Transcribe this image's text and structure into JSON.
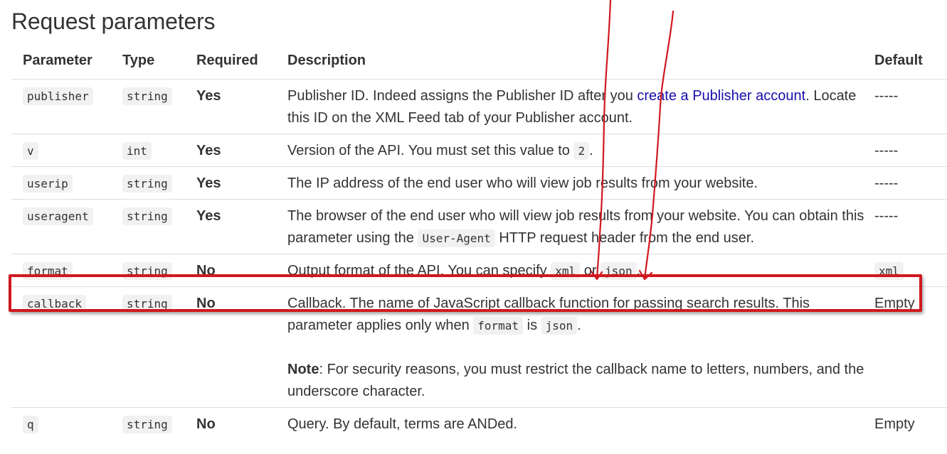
{
  "page": {
    "title": "Request parameters"
  },
  "table": {
    "headers": {
      "parameter": "Parameter",
      "type": "Type",
      "required": "Required",
      "description": "Description",
      "default": "Default"
    },
    "rows": [
      {
        "parameter": "publisher",
        "type": "string",
        "required": "Yes",
        "desc": {
          "text1": "Publisher ID. Indeed assigns the Publisher ID after you ",
          "link": "create a Publisher account",
          "text2": ". Locate this ID on the XML Feed tab of your Publisher account."
        },
        "default": "-----"
      },
      {
        "parameter": "v",
        "type": "int",
        "required": "Yes",
        "desc": {
          "text1": "Version of the API. You must set this value to ",
          "code1": "2",
          "text2": "."
        },
        "default": "-----"
      },
      {
        "parameter": "userip",
        "type": "string",
        "required": "Yes",
        "desc": {
          "text1": "The IP address of the end user who will view job results from your website."
        },
        "default": "-----"
      },
      {
        "parameter": "useragent",
        "type": "string",
        "required": "Yes",
        "desc": {
          "text1": "The browser of the end user who will view job results from your website. You can obtain this parameter using the ",
          "code1": "User-Agent",
          "text2": " HTTP request header from the end user."
        },
        "default": "-----"
      },
      {
        "parameter": "format",
        "type": "string",
        "required": "No",
        "desc": {
          "text1": "Output format of the API. You can specify ",
          "code1": "xml",
          "text2": " or ",
          "code2": "json",
          "text3": "."
        },
        "default": "xml"
      },
      {
        "parameter": "callback",
        "type": "string",
        "required": "No",
        "desc": {
          "text1": "Callback. The name of JavaScript callback function for passing search results. This parameter applies only when ",
          "code1": "format",
          "text2": " is ",
          "code2": "json",
          "text3": ".",
          "note_label": "Note",
          "note_text": ": For security reasons, you must restrict the callback name to letters, numbers, and the underscore character."
        },
        "default": "Empty"
      },
      {
        "parameter": "q",
        "type": "string",
        "required": "No",
        "desc": {
          "text1": "Query. By default, terms are ANDed."
        },
        "default": "Empty"
      }
    ]
  },
  "annotation": {
    "color": "#d0181f"
  }
}
